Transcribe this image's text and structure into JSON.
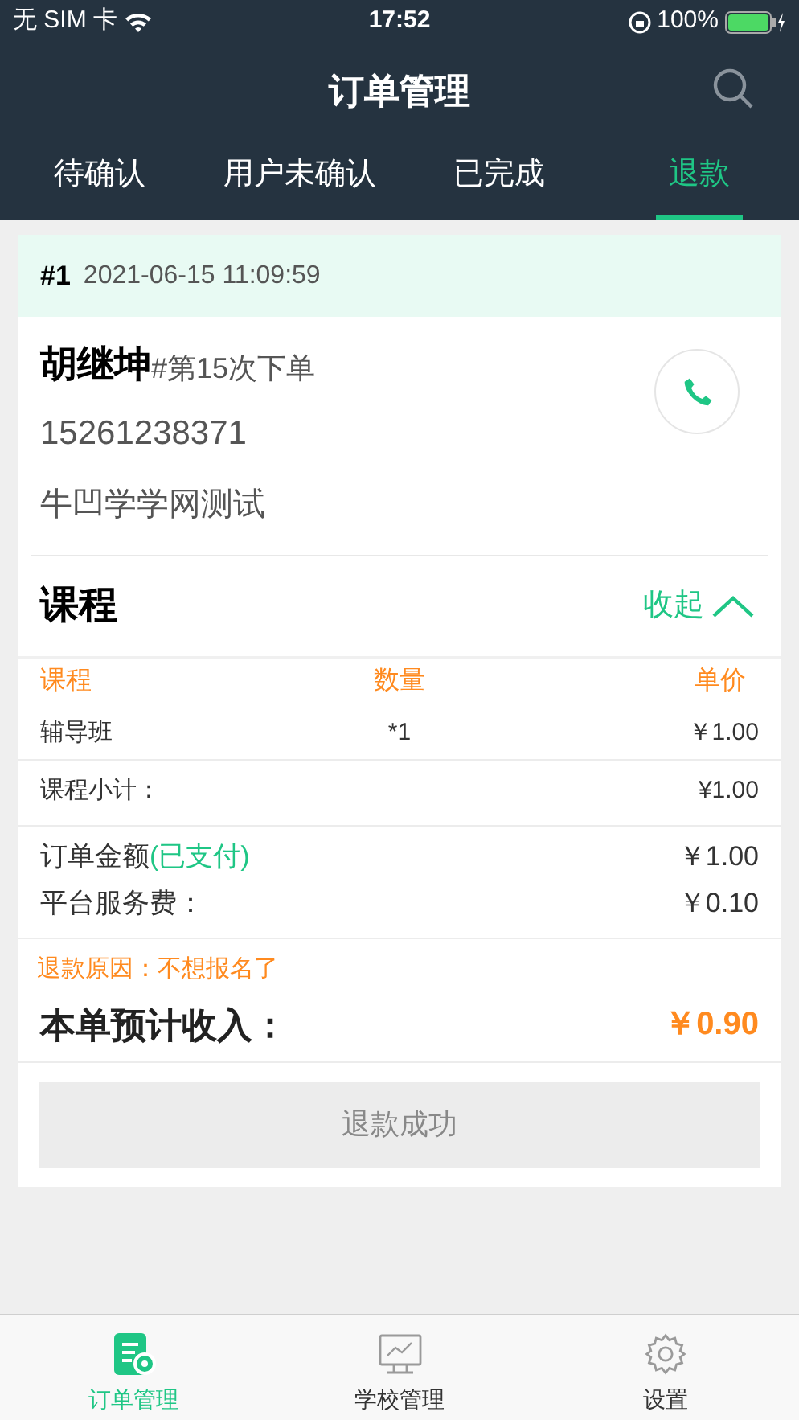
{
  "status_bar": {
    "carrier": "无 SIM 卡",
    "time": "17:52",
    "battery": "100%"
  },
  "header": {
    "title": "订单管理"
  },
  "tabs": [
    {
      "label": "待确认",
      "selected": false
    },
    {
      "label": "用户未确认",
      "selected": false
    },
    {
      "label": "已完成",
      "selected": false
    },
    {
      "label": "退款",
      "selected": true
    }
  ],
  "order": {
    "number": "#1",
    "datetime": "2021-06-15 11:09:59",
    "customer": "胡继坤",
    "order_count": "#第15次下单",
    "phone": "15261238371",
    "school": "牛凹学学网测试",
    "course_section": {
      "title": "课程",
      "toggle": "收起",
      "columns": [
        "课程",
        "数量",
        "单价"
      ],
      "rows": [
        {
          "name": "辅导班",
          "quantity": "*1",
          "price": "￥1.00"
        }
      ],
      "subtotal_label": "课程小计：",
      "subtotal": "¥1.00"
    },
    "amount_label": "订单金额",
    "paid_status": "(已支付)",
    "amount": "￥1.00",
    "fee_label": "平台服务费：",
    "fee": "￥0.10",
    "refund_reason": "退款原因：不想报名了",
    "income_label": "本单预计收入：",
    "income": "￥0.90",
    "status_button": "退款成功"
  },
  "bottom_nav": [
    {
      "label": "订单管理",
      "kind": "orders",
      "selected": true
    },
    {
      "label": "学校管理",
      "kind": "school",
      "selected": false
    },
    {
      "label": "设置",
      "kind": "settings",
      "selected": false
    }
  ]
}
